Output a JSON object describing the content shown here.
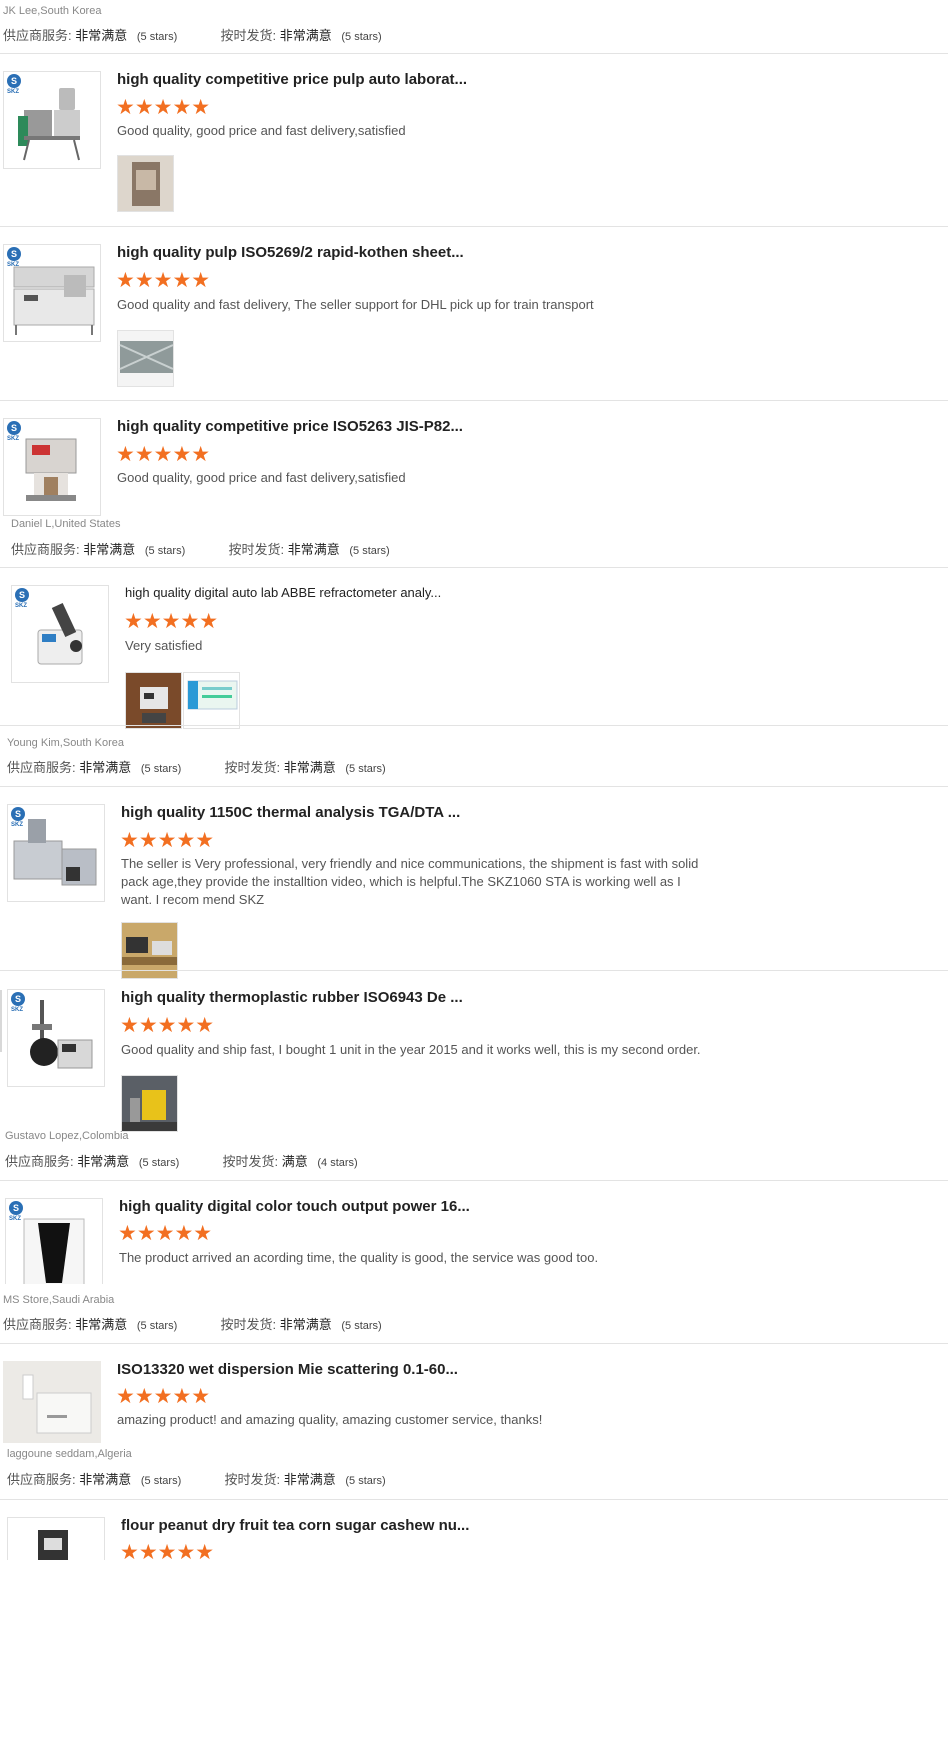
{
  "labels": {
    "service": "供应商服务:",
    "shipping": "按时发货:"
  },
  "reviews": [
    {
      "reviewer_before": "JK Lee,South Korea",
      "service_value": "非常满意",
      "service_count": "(5 stars)",
      "shipping_value": "非常满意",
      "shipping_count": "(5 stars)"
    },
    {
      "product_title": "high quality competitive price pulp auto laborat...",
      "stars": "★★★★★",
      "comment": "Good quality, good price and fast delivery,satisfied",
      "photos": [
        "bag-photo"
      ]
    },
    {
      "product_title": "high quality pulp ISO5269/2 rapid-kothen sheet...",
      "stars": "★★★★★",
      "comment": "Good quality and fast delivery, The seller support for DHL pick up for train transport",
      "photos": [
        "crate-photo"
      ]
    },
    {
      "product_title": "high quality competitive price ISO5263 JIS-P82...",
      "stars": "★★★★★",
      "comment": "Good quality, good price and fast delivery,satisfied",
      "reviewer": "Daniel L,United States",
      "service_value": "非常满意",
      "service_count": "(5 stars)",
      "shipping_value": "非常满意",
      "shipping_count": "(5 stars)"
    },
    {
      "product_title": "high quality digital auto lab ABBE refractometer analy...",
      "stars": "★★★★★",
      "comment": "Very satisfied",
      "photos": [
        "device-photo",
        "screen-photo"
      ],
      "reviewer": "Young Kim,South Korea",
      "service_value": "非常满意",
      "service_count": "(5 stars)",
      "shipping_value": "非常满意",
      "shipping_count": "(5 stars)"
    },
    {
      "product_title": "high quality 1150C thermal analysis TGA/DTA ...",
      "stars": "★★★★★",
      "comment": "The seller is Very professional, very friendly and nice communications, the shipment is fast with solid pack age,they provide the installtion video, which is helpful.The SKZ1060 STA is working well as I want. I recom mend SKZ",
      "photos": [
        "lab-photo"
      ]
    },
    {
      "product_title": "high quality thermoplastic rubber ISO6943 De ...",
      "stars": "★★★★★",
      "comment": "Good quality and ship fast, I bought 1 unit in the year 2015 and it works well, this is my second order.",
      "photos": [
        "machine-photo"
      ],
      "reviewer": "Gustavo Lopez,Colombia",
      "service_value": "非常满意",
      "service_count": "(5 stars)",
      "shipping_value": "满意",
      "shipping_count": "(4 stars)"
    },
    {
      "product_title": "high quality digital color touch output power 16...",
      "stars": "★★★★★",
      "comment": "The product arrived an acording time, the quality is good, the service was good too.",
      "reviewer": "MS Store,Saudi Arabia",
      "service_value": "非常满意",
      "service_count": "(5 stars)",
      "shipping_value": "非常满意",
      "shipping_count": "(5 stars)"
    },
    {
      "product_title": "ISO13320 wet dispersion Mie scattering 0.1-60...",
      "stars": "★★★★★",
      "comment": "amazing product! and amazing quality,  amazing customer service, thanks!",
      "reviewer": "laggoune seddam,Algeria",
      "service_value": "非常满意",
      "service_count": "(5 stars)",
      "shipping_value": "非常满意",
      "shipping_count": "(5 stars)"
    },
    {
      "product_title": "flour peanut dry fruit tea corn sugar cashew nu...",
      "stars": "★★★★★"
    }
  ],
  "brand": {
    "logo_letter": "S",
    "logo_text": "SKZ",
    "star_color": "#f26f21"
  }
}
